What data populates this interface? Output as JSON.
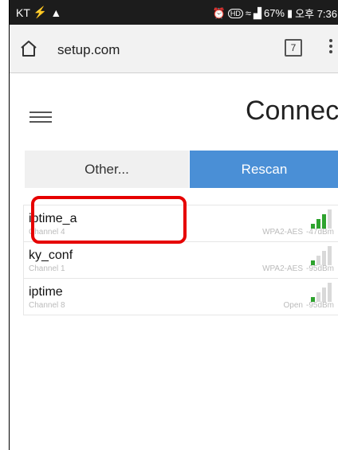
{
  "status_bar": {
    "carrier": "KT",
    "battery": "67%",
    "time": "오후 7:36"
  },
  "browser": {
    "url": "setup.com",
    "tab_count": "7"
  },
  "page": {
    "title": "Connect"
  },
  "buttons": {
    "other_label": "Other...",
    "rescan_label": "Rescan"
  },
  "networks": [
    {
      "name": "iptime_a",
      "channel": "Channel 4",
      "security": "WPA2-AES",
      "signal": "-47dBm",
      "bars": 3
    },
    {
      "name": "ky_conf",
      "channel": "Channel 1",
      "security": "WPA2-AES",
      "signal": "-95dBm",
      "bars": 1
    },
    {
      "name": "iptime",
      "channel": "Channel 8",
      "security": "Open",
      "signal": "-95dBm",
      "bars": 1
    }
  ],
  "colors": {
    "accent": "#4a8fd6",
    "signal_on": "#2ea32e",
    "highlight": "#e60000"
  }
}
